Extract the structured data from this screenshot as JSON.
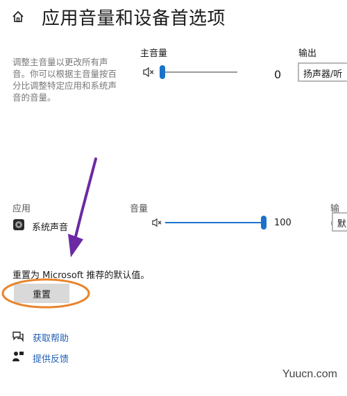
{
  "header": {
    "title": "应用音量和设备首选项",
    "home_icon": "home-icon"
  },
  "master": {
    "description": "调整主音量以更改所有声音。你可以根据主音量按百分比调整特定应用和系统声音的音量。",
    "label": "主音量",
    "value": "0",
    "level": 0,
    "output_label": "输出",
    "output_value": "扬声器/听"
  },
  "apps": {
    "col_app": "应用",
    "col_volume": "音量",
    "col_output": "输出",
    "rows": [
      {
        "name": "系统声音",
        "value": "100",
        "level": 1.0,
        "output_value": "默"
      }
    ]
  },
  "reset": {
    "text": "重置为 Microsoft 推荐的默认值。",
    "button_label": "重置"
  },
  "links": {
    "help": "获取帮助",
    "feedback": "提供反馈"
  },
  "watermark": "Yuucn.com",
  "colors": {
    "accent": "#1a73c9",
    "arrow": "#6b2aa3",
    "highlight": "#e8842c",
    "link": "#1f5fb4"
  }
}
